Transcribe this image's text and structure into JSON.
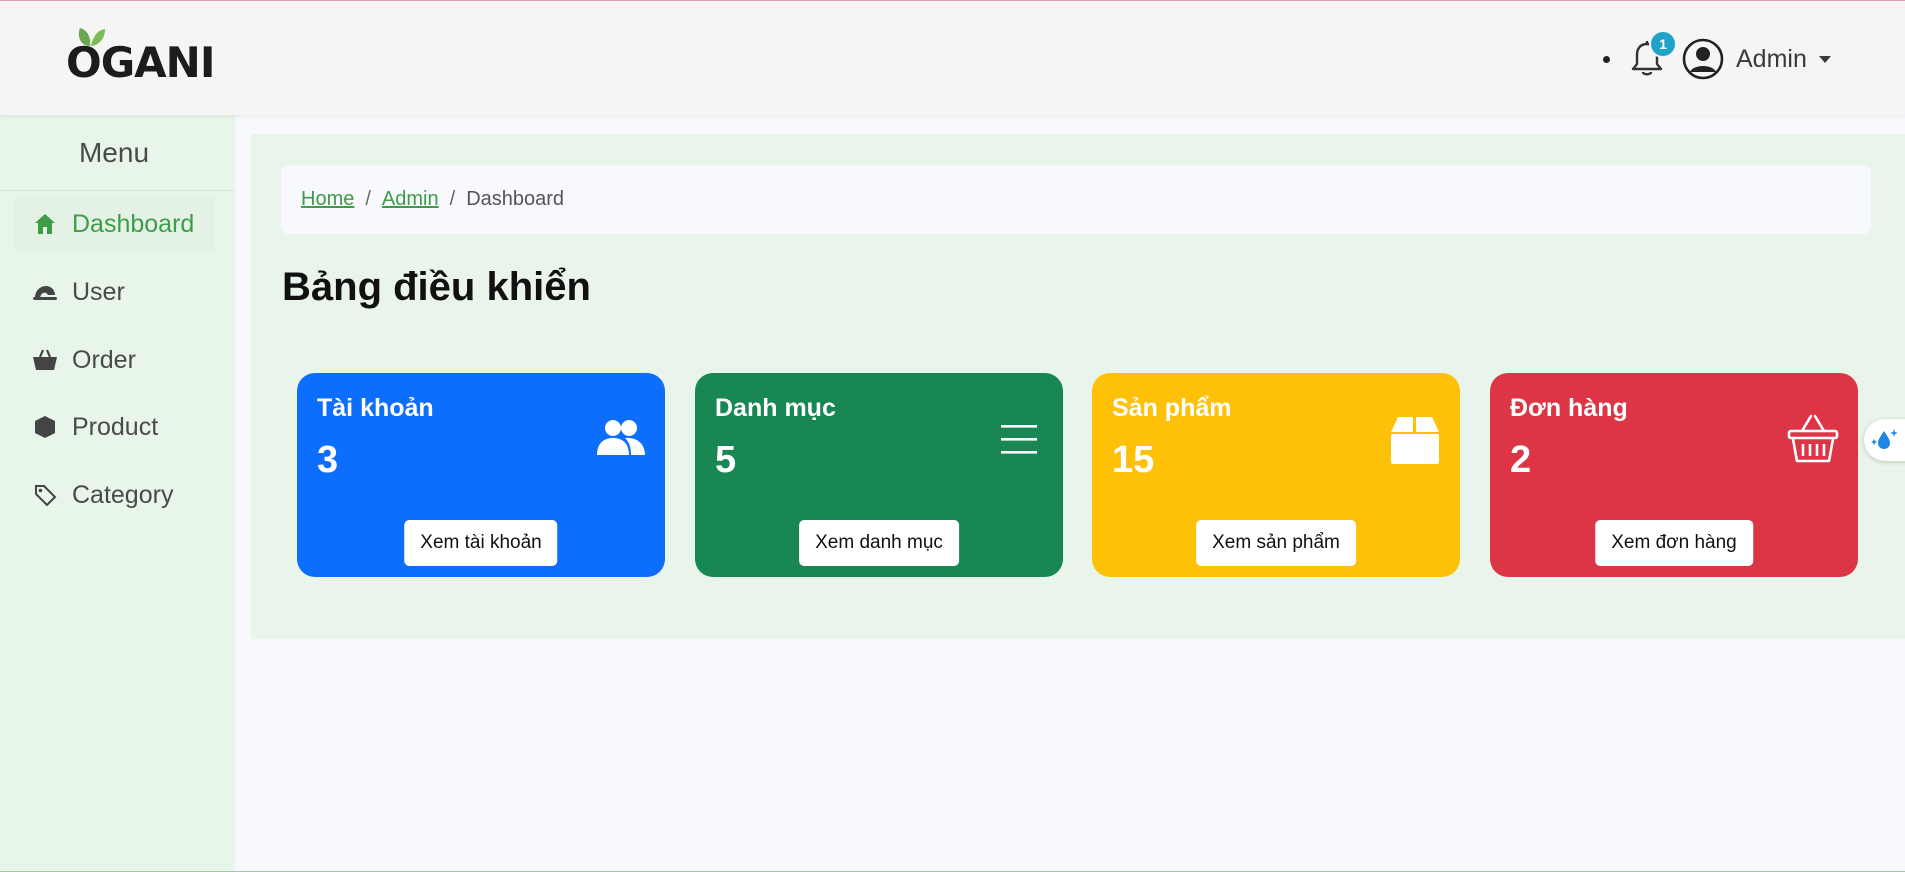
{
  "header": {
    "logo_text": "OGANI",
    "notification_count": "1",
    "user_name": "Admin",
    "icons": [
      "notification-bell-icon",
      "user-circle-icon",
      "caret-down-icon"
    ]
  },
  "sidebar": {
    "title": "Menu",
    "items": [
      {
        "label": "Dashboard",
        "icon": "home-icon",
        "active": true
      },
      {
        "label": "User",
        "icon": "user-hat-icon",
        "active": false
      },
      {
        "label": "Order",
        "icon": "basket-icon",
        "active": false
      },
      {
        "label": "Product",
        "icon": "box-icon",
        "active": false
      },
      {
        "label": "Category",
        "icon": "tag-icon",
        "active": false
      }
    ]
  },
  "breadcrumb": {
    "items": [
      "Home",
      "Admin",
      "Dashboard"
    ],
    "separator": "/"
  },
  "main": {
    "title": "Bảng điều khiển",
    "cards": [
      {
        "title": "Tài khoản",
        "value": "3",
        "button": "Xem tài khoản",
        "icon": "users-icon",
        "color": "#0d6efd"
      },
      {
        "title": "Danh mục",
        "value": "5",
        "button": "Xem danh mục",
        "icon": "list-icon",
        "color": "#198754"
      },
      {
        "title": "Sản phẩm",
        "value": "15",
        "button": "Xem sản phẩm",
        "icon": "box-icon",
        "color": "#ffc107"
      },
      {
        "title": "Đơn hàng",
        "value": "2",
        "button": "Xem đơn hàng",
        "icon": "basket-icon",
        "color": "#dc3545"
      }
    ]
  },
  "colors": {
    "accent": "#3e9c47",
    "sidebar_bg": "#e8f5e9",
    "header_bg": "#f5f5f5",
    "badge": "#1fa2c7"
  }
}
